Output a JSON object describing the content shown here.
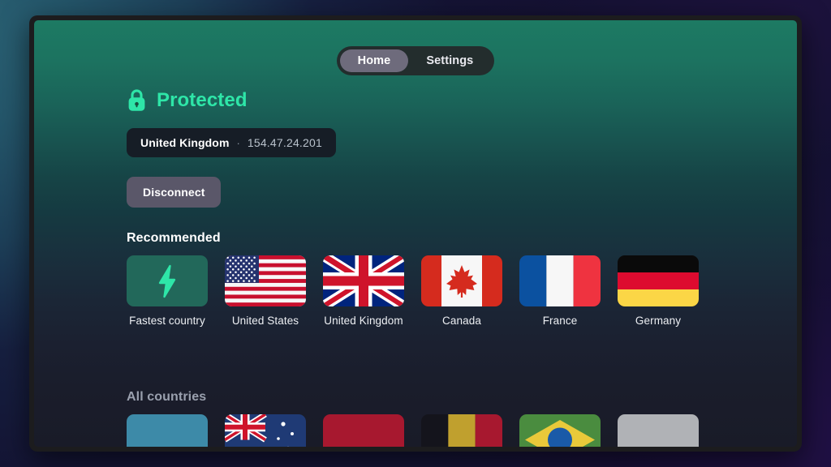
{
  "app": {
    "tabs": [
      {
        "label": "Home",
        "active": true
      },
      {
        "label": "Settings",
        "active": false
      }
    ],
    "status": {
      "icon": "lock-icon",
      "label": "Protected",
      "color": "#2ee6a8"
    },
    "server": {
      "country": "United Kingdom",
      "separator": "·",
      "ip": "154.47.24.201"
    },
    "actions": {
      "disconnect_label": "Disconnect"
    },
    "sections": [
      {
        "id": "recommended",
        "title": "Recommended",
        "items": [
          {
            "label": "Fastest country",
            "flag": "fastest"
          },
          {
            "label": "United States",
            "flag": "us"
          },
          {
            "label": "United Kingdom",
            "flag": "gb"
          },
          {
            "label": "Canada",
            "flag": "ca"
          },
          {
            "label": "France",
            "flag": "fr"
          },
          {
            "label": "Germany",
            "flag": "de"
          }
        ]
      },
      {
        "id": "all_countries",
        "title": "All countries",
        "items": [
          {
            "label": "",
            "flag": "ar"
          },
          {
            "label": "",
            "flag": "au"
          },
          {
            "label": "",
            "flag": "at"
          },
          {
            "label": "",
            "flag": "be"
          },
          {
            "label": "",
            "flag": "br"
          },
          {
            "label": "",
            "flag": "generic"
          }
        ]
      }
    ]
  }
}
